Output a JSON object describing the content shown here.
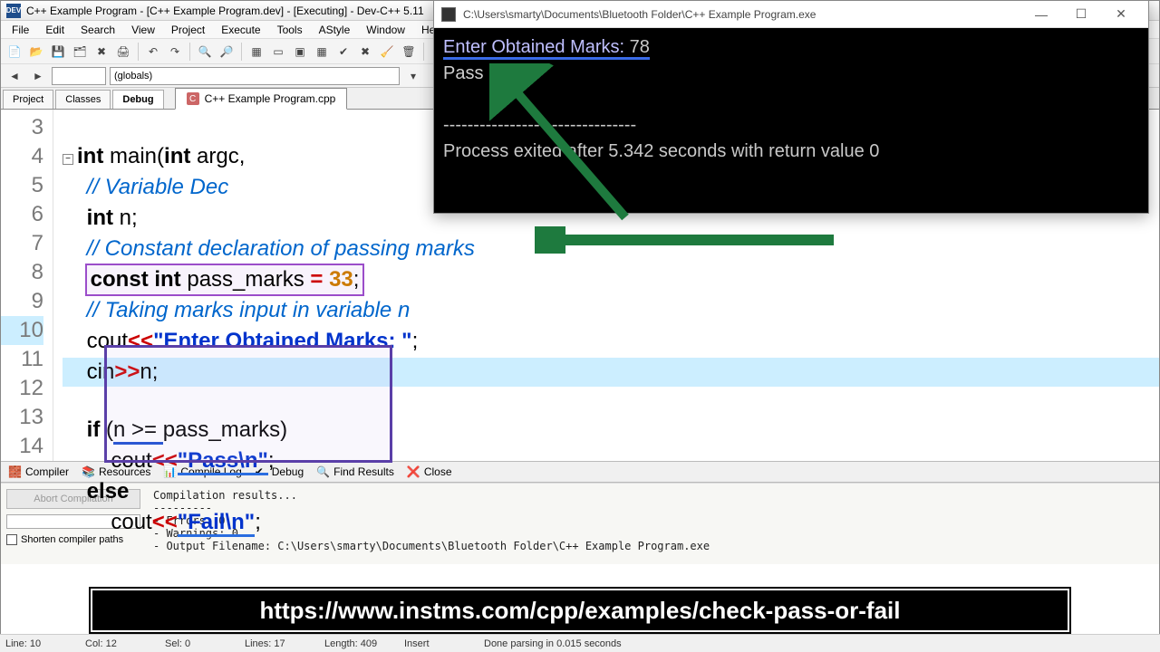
{
  "window": {
    "title": "C++ Example Program - [C++ Example Program.dev] - [Executing] - Dev-C++ 5.11"
  },
  "menus": [
    "File",
    "Edit",
    "Search",
    "View",
    "Project",
    "Execute",
    "Tools",
    "AStyle",
    "Window",
    "Help"
  ],
  "globals_combo": "(globals)",
  "side_tabs": [
    "Project",
    "Classes",
    "Debug"
  ],
  "active_side_tab": "Debug",
  "editor_tab": {
    "label": "C++ Example Program.cpp"
  },
  "line_numbers": [
    "3",
    "4",
    "5",
    "6",
    "7",
    "8",
    "9",
    "10",
    "11",
    "12",
    "13",
    "14"
  ],
  "highlight_line": "10",
  "code": {
    "l3_a": "int",
    "l3_b": "main",
    "l3_c": "int",
    "l3_d": "argc",
    "l4": "// Variable Dec",
    "l5_a": "int",
    "l5_b": "n;",
    "l6": "// Constant declaration of passing marks",
    "l7_a": "const int",
    "l7_b": "pass_marks",
    "l7_c": " = ",
    "l7_d": "33",
    "l7_e": ";",
    "l8": "// Taking marks input in variable n",
    "l9_a": "cout",
    "l9_b": "<<",
    "l9_c": "\"Enter Obtained Marks: \"",
    "l9_d": ";",
    "l10_a": "cin",
    "l10_b": ">>",
    "l10_c": "n;",
    "l11_a": "if",
    "l11_b": " (",
    "l11_c": "n >= ",
    "l11_d": "pass_marks)",
    "l12_a": "cout",
    "l12_b": "<<",
    "l12_c": "\"Pass\\n\"",
    "l12_d": ";",
    "l13": "else",
    "l14_a": "cout",
    "l14_b": "<<",
    "l14_c": "\"Fail\\n\"",
    "l14_d": ";"
  },
  "bottom_tabs": [
    "Compiler",
    "Resources",
    "Compile Log",
    "Debug",
    "Find Results",
    "Close"
  ],
  "compile": {
    "abort": "Abort Compilation",
    "shorten": "Shorten compiler paths",
    "out": "Compilation results...\n---------\n- Errors: 0\n- Warnings: 0\n- Output Filename: C:\\Users\\smarty\\Documents\\Bluetooth Folder\\C++ Example Program.exe"
  },
  "status": {
    "line": "Line:   10",
    "col": "Col:   12",
    "sel": "Sel:   0",
    "lines": "Lines:   17",
    "length": "Length:   409",
    "mode": "Insert",
    "done": "Done parsing in 0.015 seconds"
  },
  "url_overlay": "https://www.instms.com/cpp/examples/check-pass-or-fail",
  "console": {
    "title": "C:\\Users\\smarty\\Documents\\Bluetooth Folder\\C++ Example Program.exe",
    "line1_a": "Enter Obtained Marks: ",
    "line1_b": "78",
    "line2": "Pass",
    "dashes": "--------------------------------",
    "line4": "Process exited after 5.342 seconds with return value 0"
  }
}
